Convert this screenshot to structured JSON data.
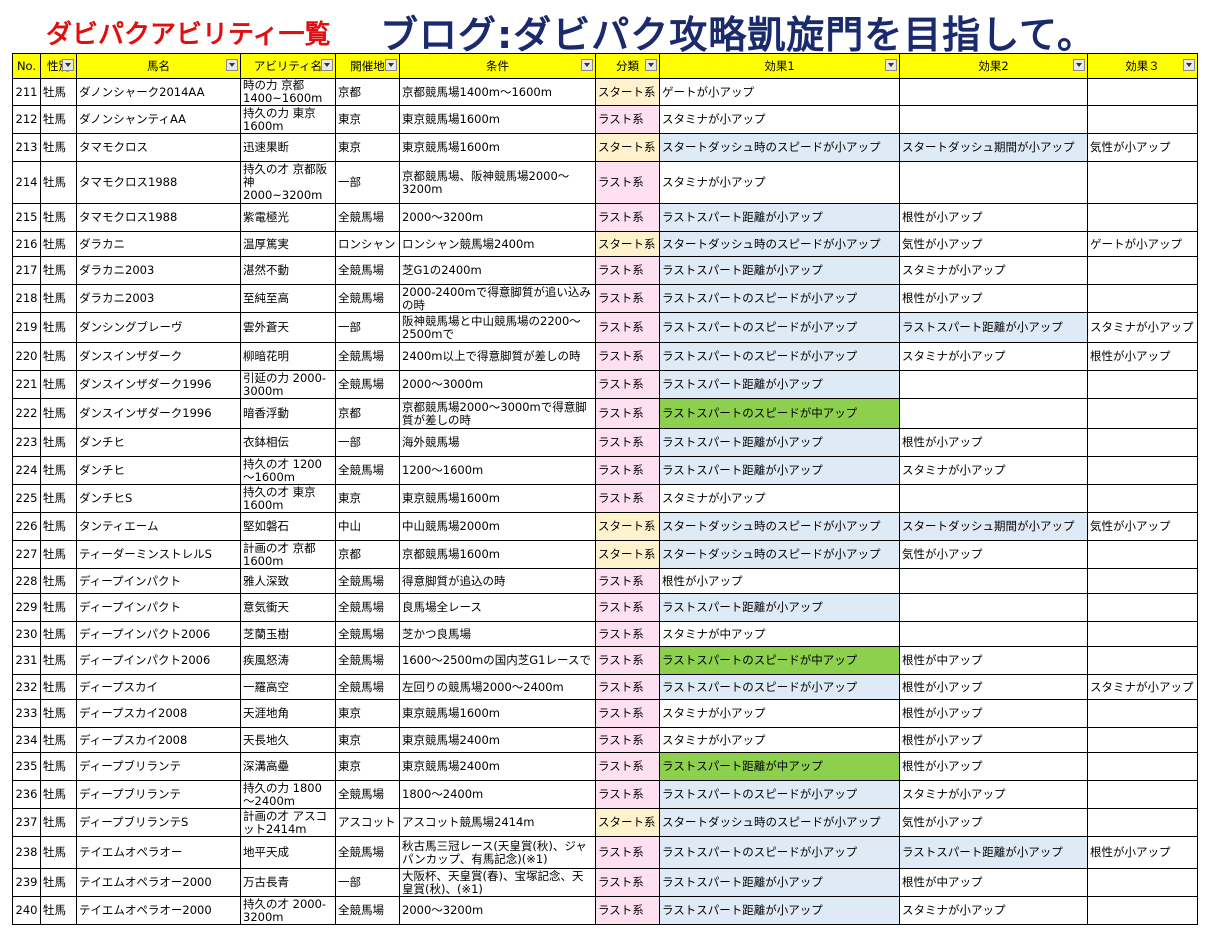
{
  "title_left": "ダビパクアビリティ一覧",
  "title_right": "ブログ:ダビパク攻略凱旋門を目指して。",
  "headers": [
    "No.",
    "性別",
    "馬名",
    "アビリティ名",
    "開催地",
    "条件",
    "分類",
    "効果1",
    "効果2",
    "効果３"
  ],
  "rows": [
    {
      "no": "211",
      "sex": "牡馬",
      "horse": "ダノンシャーク2014AA",
      "ability": "時の力 京都 1400~1600m",
      "venue": "京都",
      "cond": "京都競馬場1400m～1600m",
      "cls": "スタート系",
      "e1": "ゲートが小アップ",
      "e2": "",
      "e3": ""
    },
    {
      "no": "212",
      "sex": "牡馬",
      "horse": "ダノンシャンティAA",
      "ability": "持久の力 東京 1600m",
      "venue": "東京",
      "cond": "東京競馬場1600m",
      "cls": "ラスト系",
      "e1": "スタミナが小アップ",
      "e2": "",
      "e3": ""
    },
    {
      "no": "213",
      "sex": "牡馬",
      "horse": "タマモクロス",
      "ability": "迅速果断",
      "venue": "東京",
      "cond": "東京競馬場1600m",
      "cls": "スタート系",
      "e1": "スタートダッシュ時のスピードが小アップ",
      "e2": "スタートダッシュ期間が小アップ",
      "e3": "気性が小アップ"
    },
    {
      "no": "214",
      "sex": "牡馬",
      "horse": "タマモクロス1988",
      "ability": "持久の才 京都阪神2000~3200m",
      "venue": "一部",
      "cond": "京都競馬場、阪神競馬場2000～3200m",
      "cls": "ラスト系",
      "e1": "スタミナが小アップ",
      "e2": "",
      "e3": ""
    },
    {
      "no": "215",
      "sex": "牡馬",
      "horse": "タマモクロス1988",
      "ability": "紫電極光",
      "venue": "全競馬場",
      "cond": "2000～3200m",
      "cls": "ラスト系",
      "e1": "ラストスパート距離が小アップ",
      "e2": "根性が小アップ",
      "e3": ""
    },
    {
      "no": "216",
      "sex": "牡馬",
      "horse": "ダラカニ",
      "ability": "温厚篤実",
      "venue": "ロンシャン",
      "cond": "ロンシャン競馬場2400m",
      "cls": "スタート系",
      "e1": "スタートダッシュ時のスピードが小アップ",
      "e2": "気性が小アップ",
      "e3": "ゲートが小アップ"
    },
    {
      "no": "217",
      "sex": "牡馬",
      "horse": "ダラカニ2003",
      "ability": "湛然不動",
      "venue": "全競馬場",
      "cond": "芝G1の2400m",
      "cls": "ラスト系",
      "e1": "ラストスパート距離が小アップ",
      "e2": "スタミナが小アップ",
      "e3": ""
    },
    {
      "no": "218",
      "sex": "牡馬",
      "horse": "ダラカニ2003",
      "ability": "至純至高",
      "venue": "全競馬場",
      "cond": "2000-2400mで得意脚質が追い込みの時",
      "cls": "ラスト系",
      "e1": "ラストスパートのスピードが小アップ",
      "e2": "根性が小アップ",
      "e3": ""
    },
    {
      "no": "219",
      "sex": "牡馬",
      "horse": "ダンシングブレーヴ",
      "ability": "雲外蒼天",
      "venue": "一部",
      "cond": "阪神競馬場と中山競馬場の2200～2500mで",
      "cls": "ラスト系",
      "e1": "ラストスパートのスピードが小アップ",
      "e2": "ラストスパート距離が小アップ",
      "e3": "スタミナが小アップ"
    },
    {
      "no": "220",
      "sex": "牡馬",
      "horse": "ダンスインザダーク",
      "ability": "柳暗花明",
      "venue": "全競馬場",
      "cond": "2400m以上で得意脚質が差しの時",
      "cls": "ラスト系",
      "e1": "ラストスパートのスピードが小アップ",
      "e2": "スタミナが小アップ",
      "e3": "根性が小アップ"
    },
    {
      "no": "221",
      "sex": "牡馬",
      "horse": "ダンスインザダーク1996",
      "ability": "引延の力 2000-3000m",
      "venue": "全競馬場",
      "cond": "2000～3000m",
      "cls": "ラスト系",
      "e1": "ラストスパート距離が小アップ",
      "e2": "",
      "e3": ""
    },
    {
      "no": "222",
      "sex": "牡馬",
      "horse": "ダンスインザダーク1996",
      "ability": "暗香浮動",
      "venue": "京都",
      "cond": "京都競馬場2000～3000mで得意脚質が差しの時",
      "cls": "ラスト系",
      "e1": "ラストスパートのスピードが中アップ",
      "e2": "",
      "e3": ""
    },
    {
      "no": "223",
      "sex": "牡馬",
      "horse": "ダンチヒ",
      "ability": "衣鉢相伝",
      "venue": "一部",
      "cond": "海外競馬場",
      "cls": "ラスト系",
      "e1": "ラストスパート距離が小アップ",
      "e2": "根性が小アップ",
      "e3": ""
    },
    {
      "no": "224",
      "sex": "牡馬",
      "horse": "ダンチヒ",
      "ability": "持久の才 1200～1600m",
      "venue": "全競馬場",
      "cond": "1200～1600m",
      "cls": "ラスト系",
      "e1": "ラストスパート距離が小アップ",
      "e2": "スタミナが小アップ",
      "e3": ""
    },
    {
      "no": "225",
      "sex": "牡馬",
      "horse": "ダンチヒS",
      "ability": "持久の才 東京 1600m",
      "venue": "東京",
      "cond": "東京競馬場1600m",
      "cls": "ラスト系",
      "e1": "スタミナが小アップ",
      "e2": "",
      "e3": ""
    },
    {
      "no": "226",
      "sex": "牡馬",
      "horse": "タンティエーム",
      "ability": "堅如磐石",
      "venue": "中山",
      "cond": "中山競馬場2000m",
      "cls": "スタート系",
      "e1": "スタートダッシュ時のスピードが小アップ",
      "e2": "スタートダッシュ期間が小アップ",
      "e3": "気性が小アップ"
    },
    {
      "no": "227",
      "sex": "牡馬",
      "horse": "ティーダーミンストレルS",
      "ability": "計画の才 京都 1600m",
      "venue": "京都",
      "cond": "京都競馬場1600m",
      "cls": "スタート系",
      "e1": "スタートダッシュ時のスピードが小アップ",
      "e2": "気性が小アップ",
      "e3": ""
    },
    {
      "no": "228",
      "sex": "牡馬",
      "horse": "ディープインパクト",
      "ability": "雅人深致",
      "venue": "全競馬場",
      "cond": "得意脚質が追込の時",
      "cls": "ラスト系",
      "e1": "根性が小アップ",
      "e2": "",
      "e3": ""
    },
    {
      "no": "229",
      "sex": "牡馬",
      "horse": "ディープインパクト",
      "ability": "意気衝天",
      "venue": "全競馬場",
      "cond": "良馬場全レース",
      "cls": "ラスト系",
      "e1": "ラストスパート距離が小アップ",
      "e2": "",
      "e3": ""
    },
    {
      "no": "230",
      "sex": "牡馬",
      "horse": "ディープインパクト2006",
      "ability": "芝蘭玉樹",
      "venue": "全競馬場",
      "cond": "芝かつ良馬場",
      "cls": "ラスト系",
      "e1": "スタミナが中アップ",
      "e2": "",
      "e3": ""
    },
    {
      "no": "231",
      "sex": "牡馬",
      "horse": "ディープインパクト2006",
      "ability": "疾風怒涛",
      "venue": "全競馬場",
      "cond": "1600～2500mの国内芝G1レースで",
      "cls": "ラスト系",
      "e1": "ラストスパートのスピードが中アップ",
      "e2": "根性が中アップ",
      "e3": ""
    },
    {
      "no": "232",
      "sex": "牡馬",
      "horse": "ディープスカイ",
      "ability": "一羅高空",
      "venue": "全競馬場",
      "cond": "左回りの競馬場2000～2400m",
      "cls": "ラスト系",
      "e1": "ラストスパートのスピードが小アップ",
      "e2": "根性が小アップ",
      "e3": "スタミナが小アップ"
    },
    {
      "no": "233",
      "sex": "牡馬",
      "horse": "ディープスカイ2008",
      "ability": "天涯地角",
      "venue": "東京",
      "cond": "東京競馬場1600m",
      "cls": "ラスト系",
      "e1": "スタミナが小アップ",
      "e2": "根性が小アップ",
      "e3": ""
    },
    {
      "no": "234",
      "sex": "牡馬",
      "horse": "ディープスカイ2008",
      "ability": "天長地久",
      "venue": "東京",
      "cond": "東京競馬場2400m",
      "cls": "ラスト系",
      "e1": "スタミナが小アップ",
      "e2": "根性が小アップ",
      "e3": ""
    },
    {
      "no": "235",
      "sex": "牡馬",
      "horse": "ディープブリランテ",
      "ability": "深溝高壘",
      "venue": "東京",
      "cond": "東京競馬場2400m",
      "cls": "ラスト系",
      "e1": "ラストスパート距離が中アップ",
      "e2": "根性が小アップ",
      "e3": ""
    },
    {
      "no": "236",
      "sex": "牡馬",
      "horse": "ディープブリランテ",
      "ability": "持久の力 1800～2400m",
      "venue": "全競馬場",
      "cond": "1800～2400m",
      "cls": "ラスト系",
      "e1": "ラストスパートのスピードが小アップ",
      "e2": "スタミナが小アップ",
      "e3": ""
    },
    {
      "no": "237",
      "sex": "牡馬",
      "horse": "ディープブリランテS",
      "ability": "計画の才 アスコット2414m",
      "venue": "アスコット",
      "cond": "アスコット競馬場2414m",
      "cls": "スタート系",
      "e1": "スタートダッシュ時のスピードが小アップ",
      "e2": "気性が小アップ",
      "e3": ""
    },
    {
      "no": "238",
      "sex": "牡馬",
      "horse": "テイエムオペラオー",
      "ability": "地平天成",
      "venue": "全競馬場",
      "cond": "秋古馬三冠レース(天皇賞(秋)、ジャパンカップ、有馬記念)(※1)",
      "cls": "ラスト系",
      "e1": "ラストスパートのスピードが小アップ",
      "e2": "ラストスパート距離が小アップ",
      "e3": "根性が小アップ"
    },
    {
      "no": "239",
      "sex": "牡馬",
      "horse": "テイエムオペラオー2000",
      "ability": "万古長青",
      "venue": "一部",
      "cond": "大阪杯、天皇賞(春)、宝塚記念、天皇賞(秋)、(※1)",
      "cls": "ラスト系",
      "e1": "ラストスパート距離が小アップ",
      "e2": "根性が中アップ",
      "e3": ""
    },
    {
      "no": "240",
      "sex": "牡馬",
      "horse": "テイエムオペラオー2000",
      "ability": "持久の才 2000-3200m",
      "venue": "全競馬場",
      "cond": "2000～3200m",
      "cls": "ラスト系",
      "e1": "ラストスパート距離が小アップ",
      "e2": "スタミナが小アップ",
      "e3": ""
    }
  ],
  "row_styles": [
    {
      "h": 25,
      "cls": "start",
      "e1": "",
      "e2": "",
      "e3": ""
    },
    {
      "h": 28,
      "cls": "last",
      "e1": "",
      "e2": "",
      "e3": ""
    },
    {
      "h": 28,
      "cls": "start",
      "e1": "lb",
      "e2": "lb",
      "e3": ""
    },
    {
      "h": 42,
      "cls": "last",
      "e1": "",
      "e2": "",
      "e3": ""
    },
    {
      "h": 28,
      "cls": "last",
      "e1": "lb",
      "e2": "",
      "e3": ""
    },
    {
      "h": 25,
      "cls": "start",
      "e1": "lb",
      "e2": "",
      "e3": ""
    },
    {
      "h": 28,
      "cls": "last",
      "e1": "lb",
      "e2": "",
      "e3": ""
    },
    {
      "h": 28,
      "cls": "last",
      "e1": "lb",
      "e2": "",
      "e3": ""
    },
    {
      "h": 30,
      "cls": "last",
      "e1": "lb",
      "e2": "lb",
      "e3": ""
    },
    {
      "h": 28,
      "cls": "last",
      "e1": "lb",
      "e2": "",
      "e3": ""
    },
    {
      "h": 28,
      "cls": "last",
      "e1": "lb",
      "e2": "",
      "e3": ""
    },
    {
      "h": 30,
      "cls": "last",
      "e1": "gr",
      "e2": "",
      "e3": ""
    },
    {
      "h": 28,
      "cls": "last",
      "e1": "lb",
      "e2": "",
      "e3": ""
    },
    {
      "h": 28,
      "cls": "last",
      "e1": "lb",
      "e2": "",
      "e3": ""
    },
    {
      "h": 28,
      "cls": "last",
      "e1": "",
      "e2": "",
      "e3": ""
    },
    {
      "h": 28,
      "cls": "start",
      "e1": "lb",
      "e2": "lb",
      "e3": ""
    },
    {
      "h": 28,
      "cls": "start",
      "e1": "lb",
      "e2": "",
      "e3": ""
    },
    {
      "h": 25,
      "cls": "last",
      "e1": "",
      "e2": "",
      "e3": ""
    },
    {
      "h": 28,
      "cls": "last",
      "e1": "lb",
      "e2": "",
      "e3": ""
    },
    {
      "h": 25,
      "cls": "last",
      "e1": "",
      "e2": "",
      "e3": ""
    },
    {
      "h": 28,
      "cls": "last",
      "e1": "gr",
      "e2": "",
      "e3": ""
    },
    {
      "h": 25,
      "cls": "last",
      "e1": "lb",
      "e2": "",
      "e3": ""
    },
    {
      "h": 28,
      "cls": "last",
      "e1": "",
      "e2": "",
      "e3": ""
    },
    {
      "h": 25,
      "cls": "last",
      "e1": "",
      "e2": "",
      "e3": ""
    },
    {
      "h": 28,
      "cls": "last",
      "e1": "gr",
      "e2": "",
      "e3": ""
    },
    {
      "h": 28,
      "cls": "last",
      "e1": "lb",
      "e2": "",
      "e3": ""
    },
    {
      "h": 28,
      "cls": "start",
      "e1": "lb",
      "e2": "",
      "e3": ""
    },
    {
      "h": 32,
      "cls": "last",
      "e1": "lb",
      "e2": "lb",
      "e3": ""
    },
    {
      "h": 28,
      "cls": "last",
      "e1": "lb",
      "e2": "",
      "e3": ""
    },
    {
      "h": 28,
      "cls": "last",
      "e1": "lb",
      "e2": "",
      "e3": ""
    }
  ]
}
